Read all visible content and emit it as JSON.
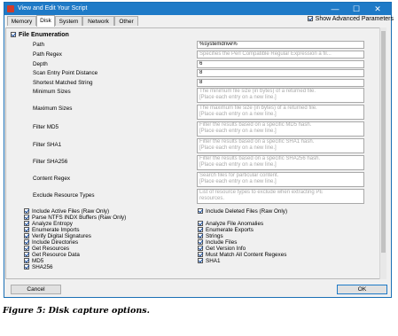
{
  "window": {
    "title": "View and Edit Your Script",
    "minimize_glyph": "—",
    "maximize_glyph": "☐",
    "close_glyph": "✕"
  },
  "tabs": [
    {
      "label": "Memory",
      "active": false
    },
    {
      "label": "Disk",
      "active": true
    },
    {
      "label": "System",
      "active": false
    },
    {
      "label": "Network",
      "active": false
    },
    {
      "label": "Other",
      "active": false
    }
  ],
  "show_advanced": {
    "label": "Show Advanced Parameters",
    "checked": true
  },
  "section": {
    "label": "File Enumeration",
    "checked": true
  },
  "fields": [
    {
      "label": "Path",
      "value": "%systemdrive%",
      "placeholder": ""
    },
    {
      "label": "Path Regex",
      "value": "",
      "placeholder": "Specifies the Perl Compatible Regular Expression a fil..."
    },
    {
      "label": "Depth",
      "value": "6",
      "placeholder": ""
    },
    {
      "label": "Scan Entry Point Distance",
      "value": "8",
      "placeholder": ""
    },
    {
      "label": "Shortest Matched String",
      "value": "8",
      "placeholder": ""
    },
    {
      "label": "Minimum Sizes",
      "value": "",
      "placeholder": "The minimum file size (in bytes) of a returned file.\n[Place each entry on a new line.]"
    },
    {
      "label": "Maximum Sizes",
      "value": "",
      "placeholder": "The maximum file size (in bytes) of a returned file.\n[Place each entry on a new line.]"
    },
    {
      "label": "Filter MD5",
      "value": "",
      "placeholder": "Filter the results based on a specific MD5 hash.\n[Place each entry on a new line.]"
    },
    {
      "label": "Filter SHA1",
      "value": "",
      "placeholder": "Filter the results based on a specific SHA1 hash.\n[Place each entry on a new line.]"
    },
    {
      "label": "Filter SHA256",
      "value": "",
      "placeholder": "Filter the results based on a specific SHA256 hash.\n[Place each entry on a new line.]"
    },
    {
      "label": "Content Regex",
      "value": "",
      "placeholder": "Search files for particular content.\n[Place each entry on a new line.]"
    },
    {
      "label": "Exclude Resource Types",
      "value": "",
      "placeholder": "List of resource types to exclude when extracting PE\nresources."
    }
  ],
  "options_left": [
    {
      "label": "Include Active Files (Raw Only)",
      "checked": true
    },
    {
      "label": "Parse NTFS INDX Buffers (Raw Only)",
      "checked": true
    },
    {
      "label": "Analyze Entropy",
      "checked": true
    },
    {
      "label": "Enumerate Imports",
      "checked": true
    },
    {
      "label": "Verify Digital Signatures",
      "checked": true
    },
    {
      "label": "Include Directories",
      "checked": true
    },
    {
      "label": "Get Resources",
      "checked": true
    },
    {
      "label": "Get Resource Data",
      "checked": true
    },
    {
      "label": "MD5",
      "checked": true
    },
    {
      "label": "SHA256",
      "checked": true
    }
  ],
  "options_right": [
    {
      "label": "Include Deleted Files (Raw Only)",
      "checked": true
    },
    {
      "label": "Analyze File Anomalies",
      "checked": true
    },
    {
      "label": "Enumerate Exports",
      "checked": true
    },
    {
      "label": "Strings",
      "checked": true
    },
    {
      "label": "Include Files",
      "checked": true
    },
    {
      "label": "Get Version Info",
      "checked": true
    },
    {
      "label": "Must Match All Content Regexes",
      "checked": true
    },
    {
      "label": "SHA1",
      "checked": true
    }
  ],
  "buttons": {
    "cancel": "Cancel",
    "ok": "OK"
  },
  "caption": "Figure 5: Disk capture options.",
  "colors": {
    "titlebar": "#1e7ac7",
    "accent_check": "#1a4fa0"
  }
}
